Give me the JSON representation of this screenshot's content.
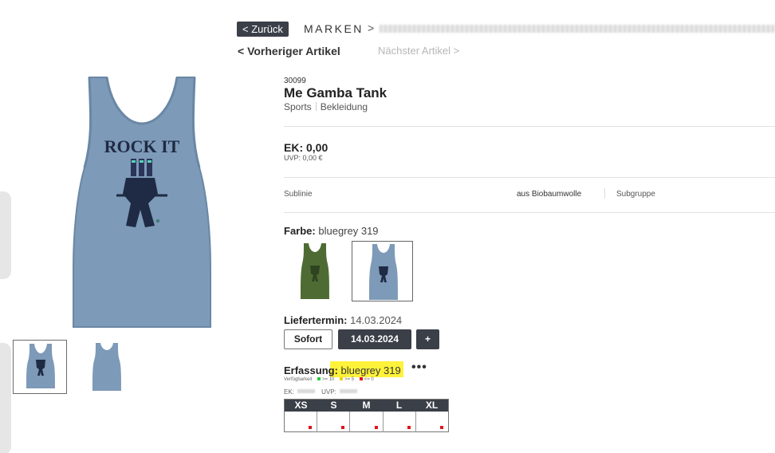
{
  "nav": {
    "back_label": "< Zurück",
    "breadcrumb_brand": "MARKEN",
    "breadcrumb_sep": ">",
    "prev_label": "< Vorheriger Artikel",
    "next_label": "Nächster Artikel >"
  },
  "product": {
    "sku": "30099",
    "name": "Me Gamba Tank",
    "category": "Sports",
    "subcategory": "Bekleidung",
    "ek": "EK: 0,00",
    "uvp": "UVP: 0,00 €",
    "sublinie_label": "Sublinie",
    "material": "aus Biobaumwolle",
    "subgruppe_label": "Subgruppe",
    "print_text": "ROCK IT",
    "colors": {
      "accent": "#3a3f48",
      "shirt_blue": "#7d9ab8",
      "shirt_green": "#4e6b34",
      "highlight": "#fff23a",
      "unavailable": "#e3141b"
    }
  },
  "color": {
    "label": "Farbe:",
    "value": "bluegrey 319"
  },
  "delivery": {
    "label": "Liefertermin:",
    "value": "14.03.2024",
    "sofort_label": "Sofort",
    "date_button": "14.03.2024",
    "plus_label": "+"
  },
  "entry": {
    "label": "Erfassung:",
    "value": "bluegrey 319",
    "more_label": "•••",
    "availability_label": "Verfügbarkeit",
    "legend_green": ">= 10",
    "legend_yellow": ">= 5",
    "legend_red": "<= 0",
    "ek_label": "EK:",
    "uvp_label": "UVP:"
  },
  "sizes": [
    "XS",
    "S",
    "M",
    "L",
    "XL"
  ]
}
